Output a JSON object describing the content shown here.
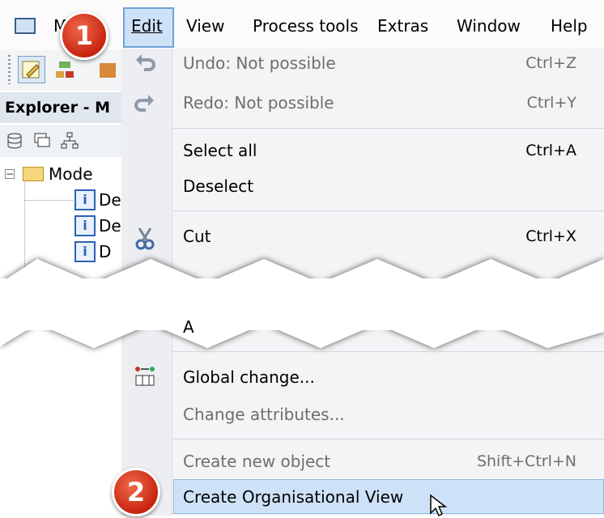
{
  "menubar": {
    "items": [
      {
        "label": "Model",
        "accel": "M"
      },
      {
        "label": "Edit",
        "accel": "E"
      },
      {
        "label": "View",
        "accel": "V"
      },
      {
        "label": "Process tools",
        "accel": "P"
      },
      {
        "label": "Extras",
        "accel": "x"
      },
      {
        "label": "Window",
        "accel": "W"
      },
      {
        "label": "Help",
        "accel": "H"
      }
    ],
    "active": "Edit"
  },
  "explorer": {
    "title": "Explorer - M",
    "tree": {
      "root_label": "Mode",
      "children": [
        "De",
        "De",
        "D"
      ]
    }
  },
  "edit_menu": {
    "items": [
      {
        "label": "Undo: Not possible",
        "shortcut": "Ctrl+Z",
        "enabled": false,
        "icon": "undo-icon"
      },
      {
        "label": "Redo: Not possible",
        "shortcut": "Ctrl+Y",
        "enabled": false,
        "icon": "redo-icon"
      },
      {
        "label": "Select all",
        "shortcut": "Ctrl+A",
        "enabled": true
      },
      {
        "label": "Deselect",
        "shortcut": "",
        "enabled": true
      },
      {
        "label": "Cut",
        "shortcut": "Ctrl+X",
        "enabled": true,
        "icon": "scissors-icon"
      },
      {
        "label": "Global change...",
        "shortcut": "",
        "enabled": true,
        "icon": "global-change-icon"
      },
      {
        "label": "Change attributes...",
        "shortcut": "",
        "enabled": false
      },
      {
        "label": "Create new object",
        "shortcut": "Shift+Ctrl+N",
        "enabled": false
      },
      {
        "label": "Create Organisational View",
        "shortcut": "",
        "enabled": true,
        "highlighted": true
      }
    ],
    "partial_label_fragment": "A"
  },
  "badges": [
    "1",
    "2"
  ],
  "colors": {
    "highlight": "#cde2f7",
    "badge": "#d6391c"
  }
}
